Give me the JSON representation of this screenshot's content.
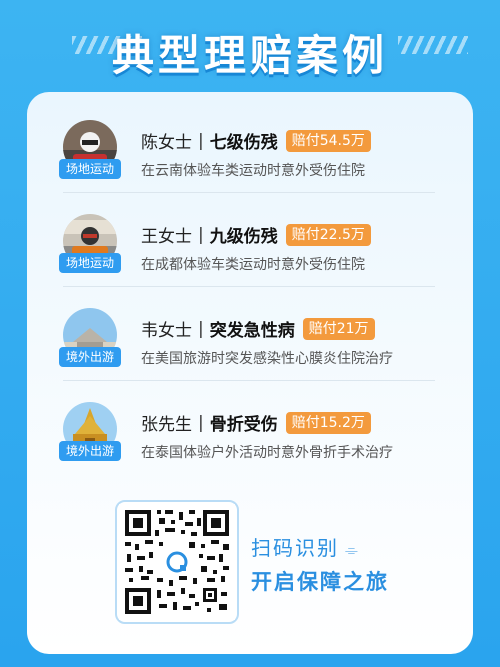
{
  "title": "典型理赔案例",
  "cases": [
    {
      "tag": "场地运动",
      "name": "陈女士",
      "injury": "七级伤残",
      "payout": "赔付54.5万",
      "desc": "在云南体验车类运动时意外受伤住院"
    },
    {
      "tag": "场地运动",
      "name": "王女士",
      "injury": "九级伤残",
      "payout": "赔付22.5万",
      "desc": "在成都体验车类运动时意外受伤住院"
    },
    {
      "tag": "境外出游",
      "name": "韦女士",
      "injury": "突发急性病",
      "payout": "赔付21万",
      "desc": "在美国旅游时突发感染性心膜炎住院治疗"
    },
    {
      "tag": "境外出游",
      "name": "张先生",
      "injury": "骨折受伤",
      "payout": "赔付15.2万",
      "desc": "在泰国体验户外活动时意外骨折手术治疗"
    }
  ],
  "separator": "|",
  "qr": {
    "scan_label": "扫码识别",
    "slogan": "开启保障之旅"
  },
  "colors": {
    "accent": "#2a8fe0",
    "payout": "#f39a3d",
    "tag": "#2f9cf0"
  }
}
